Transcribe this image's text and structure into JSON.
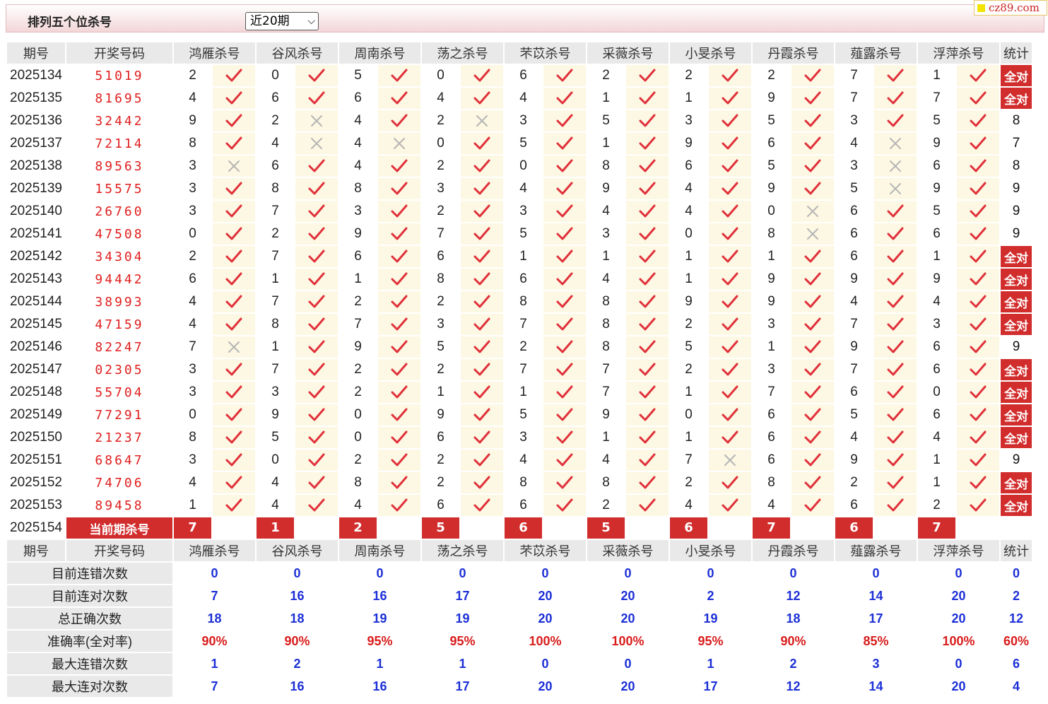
{
  "header": {
    "title": "排列五个位杀号",
    "range_select": "近20期",
    "logo_text": "cz89.com"
  },
  "columns": {
    "id": "期号",
    "draw": "开奖号码",
    "stat": "统计",
    "experts": [
      "鸿雁杀号",
      "谷风杀号",
      "周南杀号",
      "荡之杀号",
      "芣苡杀号",
      "采薇杀号",
      "小旻杀号",
      "丹霞杀号",
      "薤露杀号",
      "浮萍杀号"
    ]
  },
  "all_correct_label": "全对",
  "current_label": "当前期杀号",
  "rows": [
    {
      "id": "2025134",
      "draw": "51019",
      "kills": [
        2,
        0,
        5,
        0,
        6,
        2,
        2,
        2,
        7,
        1
      ],
      "ok": [
        1,
        1,
        1,
        1,
        1,
        1,
        1,
        1,
        1,
        1
      ],
      "stat": "全对"
    },
    {
      "id": "2025135",
      "draw": "81695",
      "kills": [
        4,
        6,
        6,
        4,
        4,
        1,
        1,
        9,
        7,
        7
      ],
      "ok": [
        1,
        1,
        1,
        1,
        1,
        1,
        1,
        1,
        1,
        1
      ],
      "stat": "全对"
    },
    {
      "id": "2025136",
      "draw": "32442",
      "kills": [
        9,
        2,
        4,
        2,
        3,
        5,
        3,
        5,
        3,
        5
      ],
      "ok": [
        1,
        0,
        1,
        0,
        1,
        1,
        1,
        1,
        1,
        1
      ],
      "stat": "8"
    },
    {
      "id": "2025137",
      "draw": "72114",
      "kills": [
        8,
        4,
        4,
        0,
        5,
        1,
        9,
        6,
        4,
        9
      ],
      "ok": [
        1,
        0,
        0,
        1,
        1,
        1,
        1,
        1,
        0,
        1
      ],
      "stat": "7"
    },
    {
      "id": "2025138",
      "draw": "89563",
      "kills": [
        3,
        6,
        4,
        2,
        0,
        8,
        6,
        5,
        3,
        6
      ],
      "ok": [
        0,
        1,
        1,
        1,
        1,
        1,
        1,
        1,
        0,
        1
      ],
      "stat": "8"
    },
    {
      "id": "2025139",
      "draw": "15575",
      "kills": [
        3,
        8,
        8,
        3,
        4,
        9,
        4,
        9,
        5,
        9
      ],
      "ok": [
        1,
        1,
        1,
        1,
        1,
        1,
        1,
        1,
        0,
        1
      ],
      "stat": "9"
    },
    {
      "id": "2025140",
      "draw": "26760",
      "kills": [
        3,
        7,
        3,
        2,
        3,
        4,
        4,
        0,
        6,
        5
      ],
      "ok": [
        1,
        1,
        1,
        1,
        1,
        1,
        1,
        0,
        1,
        1
      ],
      "stat": "9"
    },
    {
      "id": "2025141",
      "draw": "47508",
      "kills": [
        0,
        2,
        9,
        7,
        5,
        3,
        0,
        8,
        6,
        6
      ],
      "ok": [
        1,
        1,
        1,
        1,
        1,
        1,
        1,
        0,
        1,
        1
      ],
      "stat": "9"
    },
    {
      "id": "2025142",
      "draw": "34304",
      "kills": [
        2,
        7,
        6,
        6,
        1,
        1,
        1,
        1,
        6,
        1
      ],
      "ok": [
        1,
        1,
        1,
        1,
        1,
        1,
        1,
        1,
        1,
        1
      ],
      "stat": "全对"
    },
    {
      "id": "2025143",
      "draw": "94442",
      "kills": [
        6,
        1,
        1,
        8,
        6,
        4,
        1,
        9,
        9,
        9
      ],
      "ok": [
        1,
        1,
        1,
        1,
        1,
        1,
        1,
        1,
        1,
        1
      ],
      "stat": "全对"
    },
    {
      "id": "2025144",
      "draw": "38993",
      "kills": [
        4,
        7,
        2,
        2,
        8,
        8,
        9,
        9,
        4,
        4
      ],
      "ok": [
        1,
        1,
        1,
        1,
        1,
        1,
        1,
        1,
        1,
        1
      ],
      "stat": "全对"
    },
    {
      "id": "2025145",
      "draw": "47159",
      "kills": [
        4,
        8,
        7,
        3,
        7,
        8,
        2,
        3,
        7,
        3
      ],
      "ok": [
        1,
        1,
        1,
        1,
        1,
        1,
        1,
        1,
        1,
        1
      ],
      "stat": "全对"
    },
    {
      "id": "2025146",
      "draw": "82247",
      "kills": [
        7,
        1,
        9,
        5,
        2,
        8,
        5,
        1,
        9,
        6
      ],
      "ok": [
        0,
        1,
        1,
        1,
        1,
        1,
        1,
        1,
        1,
        1
      ],
      "stat": "9"
    },
    {
      "id": "2025147",
      "draw": "02305",
      "kills": [
        3,
        7,
        2,
        2,
        7,
        7,
        2,
        3,
        7,
        6
      ],
      "ok": [
        1,
        1,
        1,
        1,
        1,
        1,
        1,
        1,
        1,
        1
      ],
      "stat": "全对"
    },
    {
      "id": "2025148",
      "draw": "55704",
      "kills": [
        3,
        3,
        2,
        1,
        1,
        7,
        1,
        7,
        6,
        0
      ],
      "ok": [
        1,
        1,
        1,
        1,
        1,
        1,
        1,
        1,
        1,
        1
      ],
      "stat": "全对"
    },
    {
      "id": "2025149",
      "draw": "77291",
      "kills": [
        0,
        9,
        0,
        9,
        5,
        9,
        0,
        6,
        5,
        6
      ],
      "ok": [
        1,
        1,
        1,
        1,
        1,
        1,
        1,
        1,
        1,
        1
      ],
      "stat": "全对"
    },
    {
      "id": "2025150",
      "draw": "21237",
      "kills": [
        8,
        5,
        0,
        6,
        3,
        1,
        1,
        6,
        4,
        4
      ],
      "ok": [
        1,
        1,
        1,
        1,
        1,
        1,
        1,
        1,
        1,
        1
      ],
      "stat": "全对"
    },
    {
      "id": "2025151",
      "draw": "68647",
      "kills": [
        3,
        0,
        2,
        2,
        4,
        4,
        7,
        6,
        9,
        1
      ],
      "ok": [
        1,
        1,
        1,
        1,
        1,
        1,
        0,
        1,
        1,
        1
      ],
      "stat": "9"
    },
    {
      "id": "2025152",
      "draw": "74706",
      "kills": [
        4,
        4,
        8,
        2,
        8,
        8,
        2,
        8,
        2,
        1
      ],
      "ok": [
        1,
        1,
        1,
        1,
        1,
        1,
        1,
        1,
        1,
        1
      ],
      "stat": "全对"
    },
    {
      "id": "2025153",
      "draw": "89458",
      "kills": [
        1,
        4,
        4,
        6,
        6,
        2,
        4,
        4,
        6,
        2
      ],
      "ok": [
        1,
        1,
        1,
        1,
        1,
        1,
        1,
        1,
        1,
        1
      ],
      "stat": "全对"
    }
  ],
  "current": {
    "id": "2025154",
    "kills": [
      7,
      1,
      2,
      5,
      6,
      5,
      6,
      7,
      6,
      7
    ]
  },
  "summary": [
    {
      "label": "目前连错次数",
      "values": [
        "0",
        "0",
        "0",
        "0",
        "0",
        "0",
        "0",
        "0",
        "0",
        "0"
      ],
      "stat": "0",
      "color": "blue"
    },
    {
      "label": "目前连对次数",
      "values": [
        "7",
        "16",
        "16",
        "17",
        "20",
        "20",
        "2",
        "12",
        "14",
        "20"
      ],
      "stat": "2",
      "color": "blue"
    },
    {
      "label": "总正确次数",
      "values": [
        "18",
        "18",
        "19",
        "19",
        "20",
        "20",
        "19",
        "18",
        "17",
        "20"
      ],
      "stat": "12",
      "color": "blue"
    },
    {
      "label": "准确率(全对率)",
      "values": [
        "90%",
        "90%",
        "95%",
        "95%",
        "100%",
        "100%",
        "95%",
        "90%",
        "85%",
        "100%"
      ],
      "stat": "60%",
      "color": "red"
    },
    {
      "label": "最大连错次数",
      "values": [
        "1",
        "2",
        "1",
        "1",
        "0",
        "0",
        "1",
        "2",
        "3",
        "0"
      ],
      "stat": "6",
      "color": "blue"
    },
    {
      "label": "最大连对次数",
      "values": [
        "7",
        "16",
        "16",
        "17",
        "20",
        "20",
        "17",
        "12",
        "14",
        "20"
      ],
      "stat": "4",
      "color": "blue"
    }
  ],
  "colors": {
    "accent_red": "#d22d2d",
    "check_red": "#e0303a",
    "cross_gray": "#b5b5b5",
    "value_blue": "#1c2fd6"
  }
}
